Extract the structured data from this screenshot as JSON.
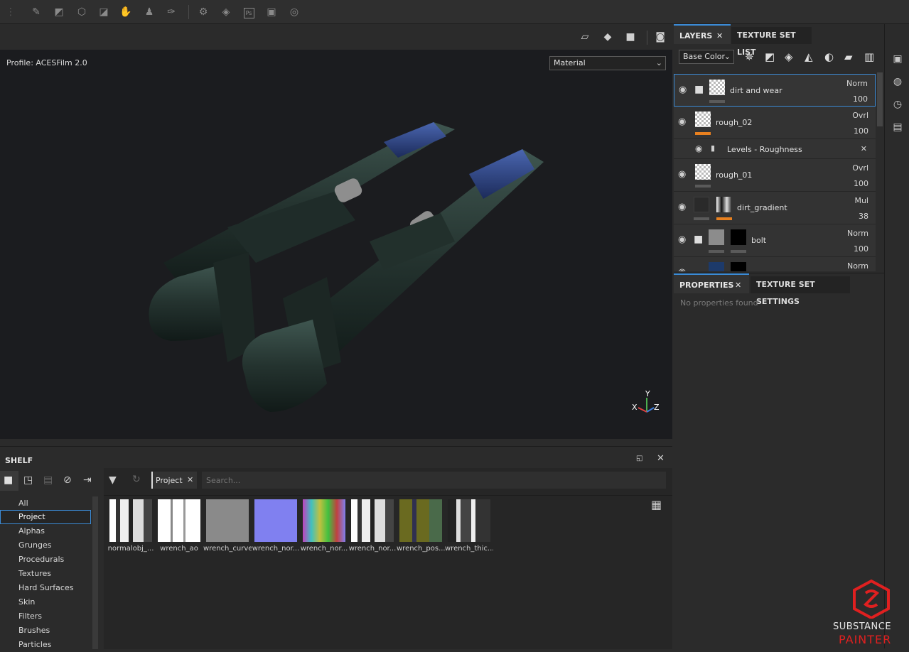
{
  "toolbar": {
    "icons": [
      "grip-icon",
      "brush-icon",
      "eraser-icon",
      "projection-icon",
      "polygon-fill-icon",
      "smudge-icon",
      "clone-icon",
      "color-picker-icon",
      "settings-icon",
      "bake-icon",
      "photoshop-icon",
      "export-icon",
      "substance-icon"
    ],
    "ps_label": "Ps"
  },
  "viewport": {
    "profile": "Profile: ACESFilm 2.0",
    "material_mode": "Material",
    "axis_x": "X",
    "axis_y": "Y",
    "axis_z": "Z"
  },
  "layers_panel": {
    "tab_layers": "LAYERS",
    "tab_texture_set_list": "TEXTURE SET LIST",
    "channel": "Base Color",
    "layers": [
      {
        "name": "dirt and wear",
        "blend": "Norm",
        "opacity": "100"
      },
      {
        "name": "rough_02",
        "blend": "Ovrl",
        "opacity": "100"
      },
      {
        "name": "Levels - Roughness"
      },
      {
        "name": "rough_01",
        "blend": "Ovrl",
        "opacity": "100"
      },
      {
        "name": "dirt_gradient",
        "blend": "Mul",
        "opacity": "38"
      },
      {
        "name": "bolt",
        "blend": "Norm",
        "opacity": "100"
      },
      {
        "blend": "Norm"
      }
    ]
  },
  "properties_panel": {
    "tab_properties": "PROPERTIES",
    "tab_texture_set_settings": "TEXTURE SET SETTINGS",
    "empty_message": "No properties found"
  },
  "shelf": {
    "title": "SHELF",
    "filter_tag": "Project",
    "search_placeholder": "Search...",
    "categories": [
      "All",
      "Project",
      "Alphas",
      "Grunges",
      "Procedurals",
      "Textures",
      "Hard Surfaces",
      "Skin",
      "Filters",
      "Brushes",
      "Particles"
    ],
    "selected_category": "Project",
    "items": [
      "normalobj_...",
      "wrench_ao",
      "wrench_curve",
      "wrench_nor...",
      "wrench_nor...",
      "wrench_nor...",
      "wrench_pos...",
      "wrench_thic..."
    ]
  },
  "branding": {
    "line1": "SUBSTANCE",
    "line2": "PAINTER",
    "color": "#e02020"
  }
}
